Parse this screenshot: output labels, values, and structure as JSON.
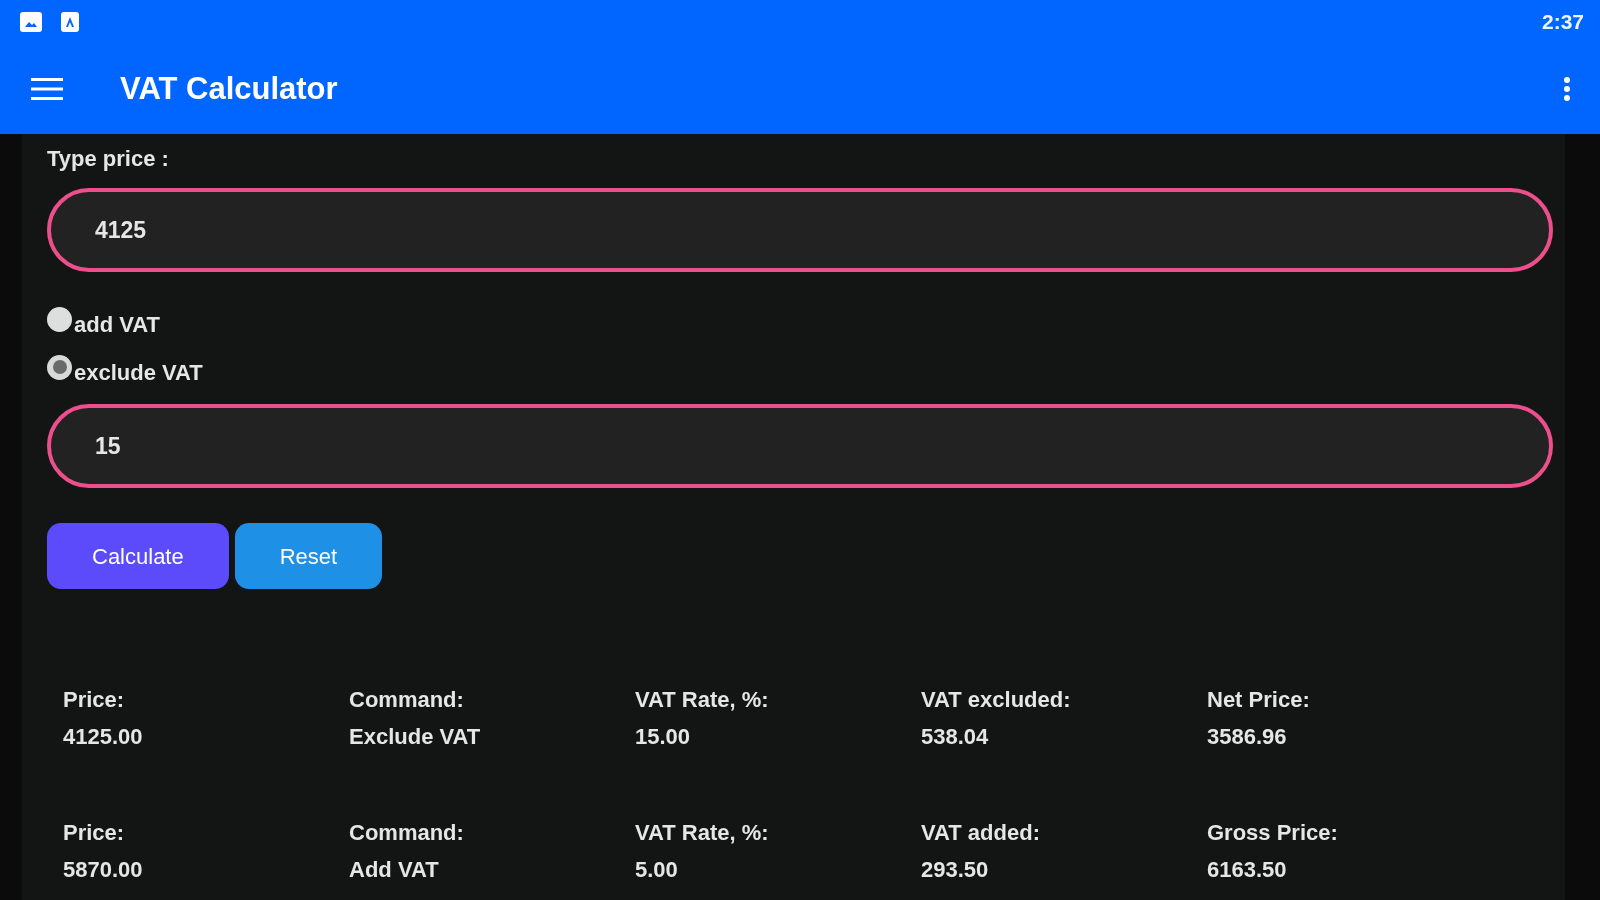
{
  "status_bar": {
    "time": "2:37"
  },
  "app_bar": {
    "title": "VAT Calculator"
  },
  "form": {
    "price_label": "Type price :",
    "price_field": {
      "value": "4125"
    },
    "options": [
      {
        "label": "add VAT",
        "selected": false
      },
      {
        "label": "exclude VAT",
        "selected": true
      }
    ],
    "rate_field": {
      "value": "15"
    },
    "buttons": [
      {
        "label": "Calculate",
        "kind": "primary"
      },
      {
        "label": "Reset",
        "kind": "secondary"
      }
    ]
  },
  "results": [
    {
      "fields": [
        {
          "label": "Price:",
          "value": "4125.00"
        },
        {
          "label": "Command:",
          "value": "Exclude VAT"
        },
        {
          "label": "VAT Rate, %:",
          "value": "15.00"
        },
        {
          "label": "VAT excluded:",
          "value": "538.04"
        },
        {
          "label": "Net Price:",
          "value": "3586.96"
        }
      ]
    },
    {
      "fields": [
        {
          "label": "Price:",
          "value": "5870.00"
        },
        {
          "label": "Command:",
          "value": "Add VAT"
        },
        {
          "label": "VAT Rate, %:",
          "value": "5.00"
        },
        {
          "label": "VAT added:",
          "value": "293.50"
        },
        {
          "label": "Gross Price:",
          "value": "6163.50"
        }
      ]
    }
  ]
}
